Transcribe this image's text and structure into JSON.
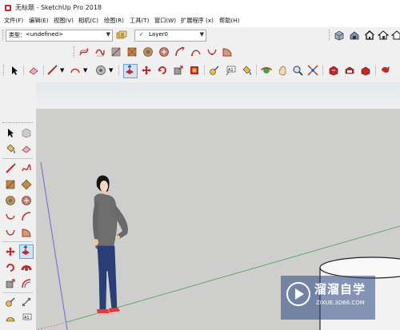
{
  "window": {
    "title": "无标题 - SketchUp Pro 2018"
  },
  "menu": {
    "items": [
      "文件(F)",
      "编辑(E)",
      "视图(V)",
      "相机(C)",
      "绘图(R)",
      "工具(T)",
      "窗口(W)",
      "扩展程序 (x)",
      "帮助(H)"
    ]
  },
  "entity_info": {
    "type_label": "类型：",
    "type_value": "<undefined>"
  },
  "layer": {
    "check": "✓",
    "name": "Layer0"
  },
  "icons": {
    "top_right": [
      "components-icon",
      "3d-warehouse-icon",
      "home-icon",
      "house-icon",
      "house-alt-icon"
    ],
    "row2": [
      "sandbox-from-contours-icon",
      "sandbox-from-scratch-icon",
      "smoove-icon",
      "stamp-icon",
      "drape-icon",
      "add-detail-icon",
      "flip-edge-icon"
    ]
  },
  "colors": {
    "sky": "#e9edf0",
    "ground": "#cfcfcc",
    "red_axis": "#d26b6b",
    "green_axis": "#4ca24c",
    "blue_axis": "#6a6acf",
    "accent_red": "#c0282a"
  },
  "watermark": {
    "title": "溜溜自学",
    "url": "ZIXUE.3D66.COM"
  }
}
